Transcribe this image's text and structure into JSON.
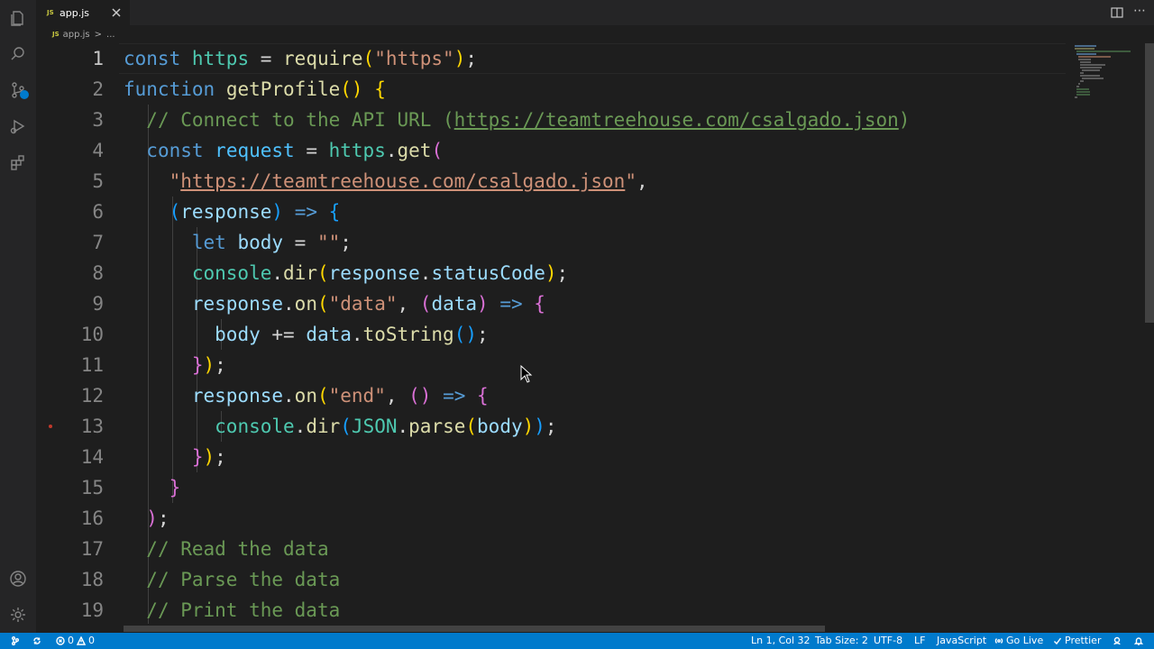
{
  "tab": {
    "badge": "JS",
    "label": "app.js"
  },
  "breadcrumb": {
    "badge": "JS",
    "file": "app.js",
    "sep": ">",
    "more": "..."
  },
  "editor": {
    "line_numbers": [
      "1",
      "2",
      "3",
      "4",
      "5",
      "6",
      "7",
      "8",
      "9",
      "10",
      "11",
      "12",
      "13",
      "14",
      "15",
      "16",
      "17",
      "18",
      "19"
    ]
  },
  "statusbar": {
    "problems_errors": "0",
    "problems_warnings": "0",
    "cursor_position": "Ln 1, Col 32",
    "tab_size": "Tab Size: 2",
    "encoding": "UTF-8",
    "eol": "LF",
    "language": "JavaScript",
    "go_live": "Go Live",
    "prettier": "Prettier"
  },
  "icons": {
    "activity": [
      "explorer-icon",
      "search-icon",
      "source-control-icon",
      "run-debug-icon",
      "extensions-icon",
      "account-icon",
      "settings-gear-icon"
    ]
  },
  "colors": {
    "status_bar": "#007acc",
    "editor_bg": "#1e1e1e",
    "keyword": "#569cd6",
    "function": "#dcdcaa",
    "string": "#ce9178",
    "comment": "#6a9955"
  }
}
